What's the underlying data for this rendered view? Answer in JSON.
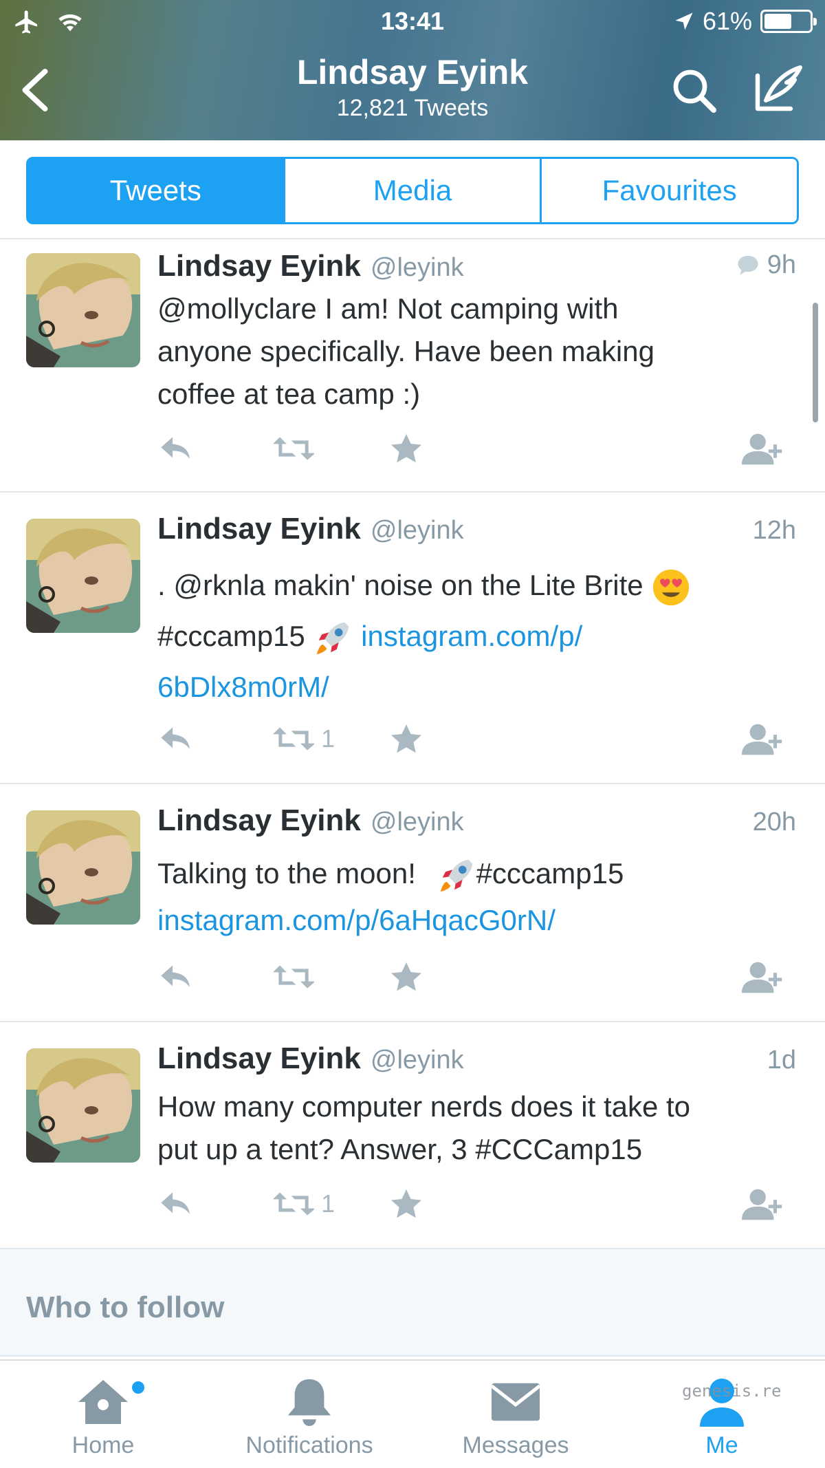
{
  "status_bar": {
    "time": "13:41",
    "battery": "61%",
    "battery_level": 0.61
  },
  "header": {
    "title": "Lindsay Eyink",
    "subtitle": "12,821 Tweets"
  },
  "tabs": [
    {
      "label": "Tweets",
      "active": true
    },
    {
      "label": "Media",
      "active": false
    },
    {
      "label": "Favourites",
      "active": false
    }
  ],
  "tweets": [
    {
      "name": "Lindsay Eyink",
      "handle": "@leyink",
      "time": "9h",
      "has_reply_icon": true,
      "line1": "@mollyclare I am! Not camping with",
      "line2": "anyone specifically. Have been making",
      "line3": "coffee at tea camp :)",
      "retweets": ""
    },
    {
      "name": "Lindsay Eyink",
      "handle": "@leyink",
      "time": "12h",
      "line1": ". @rknla makin' noise on the Lite Brite",
      "line2_text": "#cccamp15",
      "line2_link": "instagram.com/p/",
      "line3_link": "6bDlx8m0rM/",
      "retweets": "1"
    },
    {
      "name": "Lindsay Eyink",
      "handle": "@leyink",
      "time": "20h",
      "line1_text": "Talking to the moon!",
      "line1_tag": "#cccamp15",
      "line2_link": "instagram.com/p/6aHqacG0rN/",
      "retweets": ""
    },
    {
      "name": "Lindsay Eyink",
      "handle": "@leyink",
      "time": "1d",
      "line1": "How many computer nerds does it take to",
      "line2": "put up a tent? Answer, 3 #CCCamp15",
      "retweets": "1"
    }
  ],
  "who_to_follow": "Who to follow",
  "tab_bar": [
    {
      "label": "Home",
      "icon": "home-icon",
      "active": false,
      "has_dot": true
    },
    {
      "label": "Notifications",
      "icon": "bell-icon",
      "active": false
    },
    {
      "label": "Messages",
      "icon": "envelope-icon",
      "active": false
    },
    {
      "label": "Me",
      "icon": "person-icon",
      "active": true
    }
  ],
  "watermark": "genesis.re",
  "colors": {
    "accent": "#1da1f2",
    "link": "#1b95e0",
    "muted": "#8899a6",
    "icon_gray": "#aab8c2"
  }
}
